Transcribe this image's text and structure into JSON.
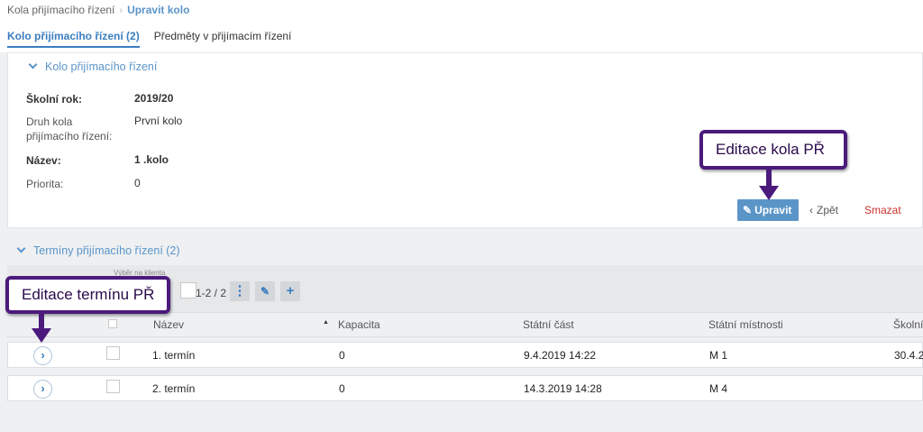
{
  "breadcrumb": {
    "parent": "Kola přijímacího řízení",
    "current": "Upravit kolo"
  },
  "tabs": [
    {
      "label": "Kolo přijímacího řízení (2)",
      "active": true
    },
    {
      "label": "Předměty v přijímacím řízení",
      "active": false
    }
  ],
  "round_section": {
    "title": "Kolo přijímacího řízení",
    "fields": [
      {
        "label": "Školní rok:",
        "value": "2019/20"
      },
      {
        "label": "Druh kola přijímacího řízení:",
        "value": "První kolo"
      },
      {
        "label": "Název:",
        "value": "1 .kolo"
      },
      {
        "label": "Priorita:",
        "value": "0"
      }
    ],
    "actions": {
      "edit": "Upravit",
      "back": "Zpět",
      "delete": "Smazat"
    }
  },
  "terms_section": {
    "title": "Termíny přijímacího řízení (2)",
    "toolbar_caption": "Výběr na klienta",
    "pager": "1-2 / 2",
    "columns": [
      "Název",
      "Kapacita",
      "Státní část",
      "Státní místnosti",
      "Školní"
    ],
    "rows": [
      {
        "name": "1. termín",
        "capacity": "0",
        "state_part": "9.4.2019 14:22",
        "state_rooms": "M 1",
        "school": "30.4.2"
      },
      {
        "name": "2. termín",
        "capacity": "0",
        "state_part": "14.3.2019 14:28",
        "state_rooms": "M 4",
        "school": ""
      }
    ]
  },
  "annotations": {
    "edit_round": "Editace kola PŘ",
    "edit_term": "Editace termínu PŘ"
  },
  "colors": {
    "accent": "#5b95c8",
    "callout_border": "#4b1a7c",
    "delete": "#c9302c"
  }
}
